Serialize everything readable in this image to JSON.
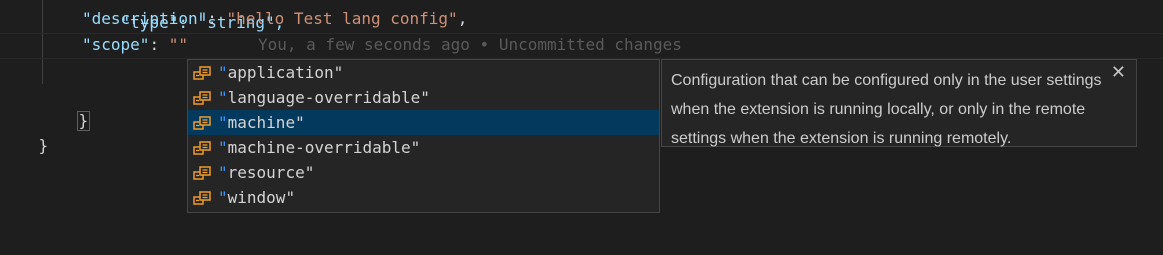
{
  "code": {
    "top_partial": "\"type\": \"string\",",
    "description": {
      "key": "\"description\"",
      "colon": ": ",
      "value": "\"hello Test lang config\"",
      "trail": ","
    },
    "scope": {
      "key": "\"scope\"",
      "colon": ": ",
      "value": "\"\""
    },
    "inline_blame": "You, a few seconds ago • Uncommitted changes",
    "closing_brace_inner": "}",
    "closing_brace_outer": "}"
  },
  "suggest": {
    "items": [
      {
        "icon": "enum-member-icon",
        "quote": "\"",
        "text": "application\""
      },
      {
        "icon": "enum-member-icon",
        "quote": "\"",
        "text": "language-overridable\""
      },
      {
        "icon": "enum-member-icon",
        "quote": "\"",
        "text": "machine\""
      },
      {
        "icon": "enum-member-icon",
        "quote": "\"",
        "text": "machine-overridable\""
      },
      {
        "icon": "enum-member-icon",
        "quote": "\"",
        "text": "resource\""
      },
      {
        "icon": "enum-member-icon",
        "quote": "\"",
        "text": "window\""
      }
    ],
    "selected_index": 2
  },
  "details": {
    "text": "Configuration that can be configured only in the user settings when the extension is running locally, or only in the remote settings when the extension is running remotely.",
    "close_glyph": "✕"
  },
  "colors": {
    "background": "#1e1e1e",
    "key": "#9cdcfe",
    "string": "#ce9178",
    "selected": "#04395e",
    "icon": "#ee9d28"
  }
}
